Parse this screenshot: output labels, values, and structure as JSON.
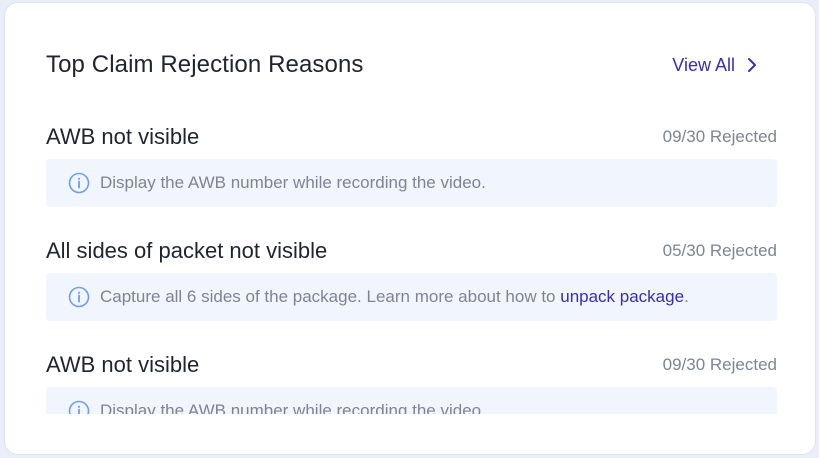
{
  "header": {
    "title": "Top Claim Rejection Reasons",
    "view_all_label": "View All"
  },
  "colors": {
    "accent": "#3a2db0",
    "hint_bg": "#f1f5fd",
    "info_icon": "#6f9ee8"
  },
  "reasons": [
    {
      "title": "AWB not visible",
      "count": "09/30 Rejected",
      "hint": "Display the AWB number while recording the video."
    },
    {
      "title": "All sides of packet not visible",
      "count": "05/30 Rejected",
      "hint_prefix": "Capture all 6 sides of the package. Learn more about how to ",
      "hint_link": "unpack package",
      "hint_suffix": "."
    },
    {
      "title": "AWB not visible",
      "count": "09/30 Rejected",
      "hint": "Display the AWB number while recording the video."
    }
  ]
}
